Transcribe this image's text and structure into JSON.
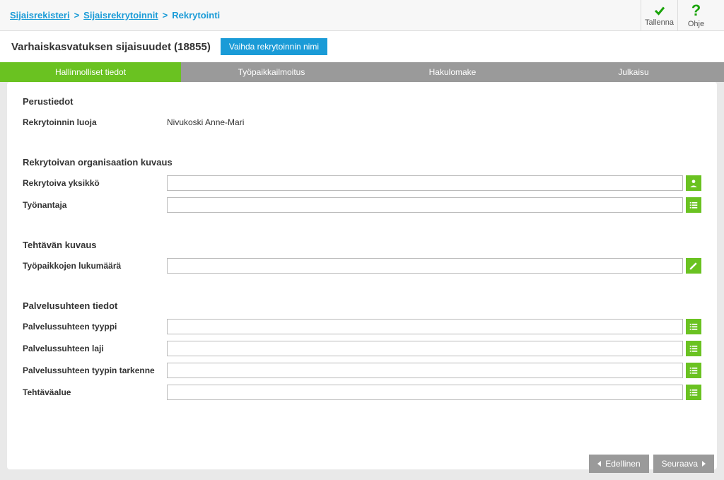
{
  "breadcrumb": {
    "items": [
      "Sijaisrekisteri",
      "Sijaisrekrytoinnit",
      "Rekrytointi"
    ]
  },
  "header_actions": {
    "save": "Tallenna",
    "help": "Ohje"
  },
  "page_title": "Varhaiskasvatuksen sijaisuudet (18855)",
  "rename_button": "Vaihda rekrytoinnin nimi",
  "tabs": [
    "Hallinnolliset tiedot",
    "Työpaikkailmoitus",
    "Hakulomake",
    "Julkaisu"
  ],
  "sections": {
    "basic": {
      "title": "Perustiedot",
      "creator_label": "Rekrytoinnin luoja",
      "creator_value": "Nivukoski Anne-Mari"
    },
    "org": {
      "title": "Rekrytoivan organisaation kuvaus",
      "unit_label": "Rekrytoiva yksikkö",
      "employer_label": "Työnantaja",
      "unit_value": "",
      "employer_value": ""
    },
    "task": {
      "title": "Tehtävän kuvaus",
      "count_label": "Työpaikkojen lukumäärä",
      "count_value": ""
    },
    "employment": {
      "title": "Palvelusuhteen tiedot",
      "type_label": "Palvelussuhteen tyyppi",
      "kind_label": "Palvelussuhteen laji",
      "type_spec_label": "Palvelussuhteen tyypin tarkenne",
      "area_label": "Tehtäväalue",
      "type_value": "",
      "kind_value": "",
      "type_spec_value": "",
      "area_value": ""
    }
  },
  "footer": {
    "prev": "Edellinen",
    "next": "Seuraava"
  }
}
